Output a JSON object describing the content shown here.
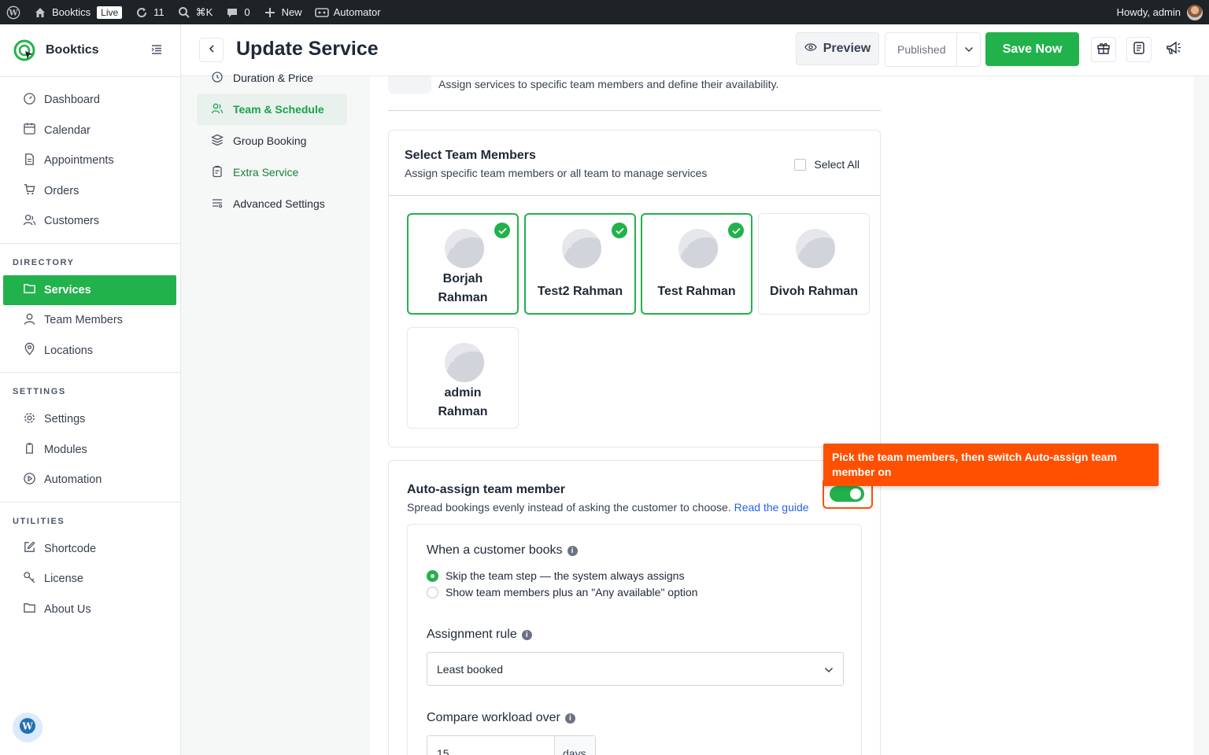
{
  "adminbar": {
    "site_name": "Booktics",
    "live_badge": "Live",
    "updates_count": "11",
    "search_shortcut": "⌘K",
    "comments_count": "0",
    "new_label": "New",
    "automator_label": "Automator",
    "howdy": "Howdy, admin"
  },
  "sidebar": {
    "brand": "Booktics",
    "main_items": [
      {
        "label": "Dashboard",
        "icon": "dashboard-icon"
      },
      {
        "label": "Calendar",
        "icon": "calendar-icon"
      },
      {
        "label": "Appointments",
        "icon": "appointments-icon"
      },
      {
        "label": "Orders",
        "icon": "cart-icon"
      },
      {
        "label": "Customers",
        "icon": "customers-icon"
      }
    ],
    "directory_heading": "DIRECTORY",
    "directory_items": [
      {
        "label": "Services",
        "icon": "folder-icon",
        "active": true
      },
      {
        "label": "Team Members",
        "icon": "user-icon"
      },
      {
        "label": "Locations",
        "icon": "location-icon"
      }
    ],
    "settings_heading": "SETTINGS",
    "settings_items": [
      {
        "label": "Settings",
        "icon": "gear-icon"
      },
      {
        "label": "Modules",
        "icon": "modules-icon"
      },
      {
        "label": "Automation",
        "icon": "play-icon"
      }
    ],
    "utilities_heading": "UTILITIES",
    "utilities_items": [
      {
        "label": "Shortcode",
        "icon": "edit-icon"
      },
      {
        "label": "License",
        "icon": "key-icon"
      },
      {
        "label": "About Us",
        "icon": "folder-icon"
      }
    ]
  },
  "header": {
    "title": "Update Service",
    "preview_label": "Preview",
    "status_value": "Published",
    "save_label": "Save Now"
  },
  "submenu": {
    "items": [
      {
        "label": "Duration & Price",
        "state": "normal"
      },
      {
        "label": "Team & Schedule",
        "state": "active"
      },
      {
        "label": "Group Booking",
        "state": "normal"
      },
      {
        "label": "Extra Service",
        "state": "link"
      },
      {
        "label": "Advanced Settings",
        "state": "normal"
      }
    ]
  },
  "section": {
    "description": "Assign services to specific team members and define their availability."
  },
  "team": {
    "title": "Select Team Members",
    "subtitle": "Assign specific team members or all team to manage services",
    "select_all_label": "Select All",
    "members": [
      {
        "name_line1": "Borjah",
        "name_line2": "Rahman",
        "selected": true
      },
      {
        "name_line1": "Test2 Rahman",
        "name_line2": "",
        "selected": true
      },
      {
        "name_line1": "Test Rahman",
        "name_line2": "",
        "selected": true
      },
      {
        "name_line1": "Divoh Rahman",
        "name_line2": "",
        "selected": false
      },
      {
        "name_line1": "admin",
        "name_line2": "Rahman",
        "selected": false
      }
    ]
  },
  "auto_assign": {
    "title": "Auto-assign team member",
    "subtitle": "Spread bookings evenly instead of asking the customer to choose.",
    "guide_link": "Read the guide",
    "enabled": true,
    "when_books_label": "When a customer books",
    "option_skip": "Skip the team step — the system always assigns",
    "option_show": "Show team members plus an \"Any available\" option",
    "selected_option": "skip",
    "rule_label": "Assignment rule",
    "rule_value": "Least booked",
    "workload_label": "Compare workload over",
    "workload_value": "15",
    "workload_unit": "days"
  },
  "tooltip": {
    "text": "Pick the team members, then switch Auto-assign team member on"
  }
}
